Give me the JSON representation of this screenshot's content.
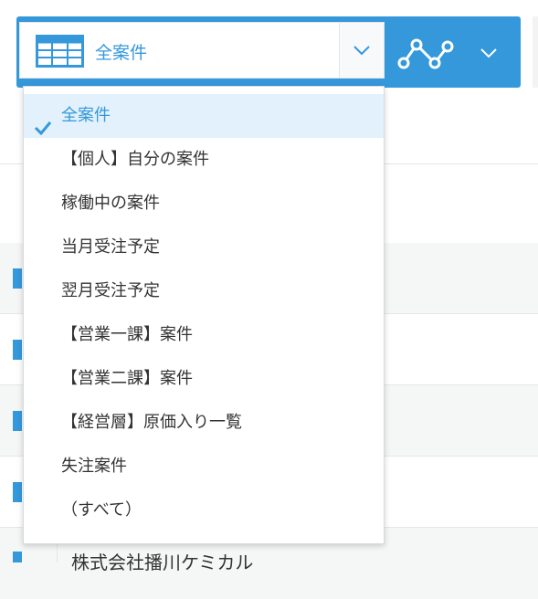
{
  "view_selector": {
    "current_view": "全案件",
    "table_icon": "table-icon",
    "dropdown_icon": "chevron-down-icon"
  },
  "graph_button": {
    "icon": "line-graph-icon",
    "menu_icon": "chevron-down-icon"
  },
  "dropdown": {
    "check_icon": "checkmark-icon",
    "items": [
      {
        "label": "全案件",
        "selected": true
      },
      {
        "label": "【個人】自分の案件",
        "selected": false
      },
      {
        "label": "稼働中の案件",
        "selected": false
      },
      {
        "label": "当月受注予定",
        "selected": false
      },
      {
        "label": "翌月受注予定",
        "selected": false
      },
      {
        "label": "【営業一課】案件",
        "selected": false
      },
      {
        "label": "【営業二課】案件",
        "selected": false
      },
      {
        "label": "【経営層】原価入り一覧",
        "selected": false
      },
      {
        "label": "失注案件",
        "selected": false
      },
      {
        "label": "（すべて）",
        "selected": false
      }
    ]
  },
  "background_list": {
    "partial_row_text": "株式会社播川ケミカル"
  },
  "colors": {
    "accent": "#3498db",
    "selected_bg": "#e2f1fb",
    "row_alt_bg": "#f5f6f6",
    "border": "#e3e7e8"
  }
}
